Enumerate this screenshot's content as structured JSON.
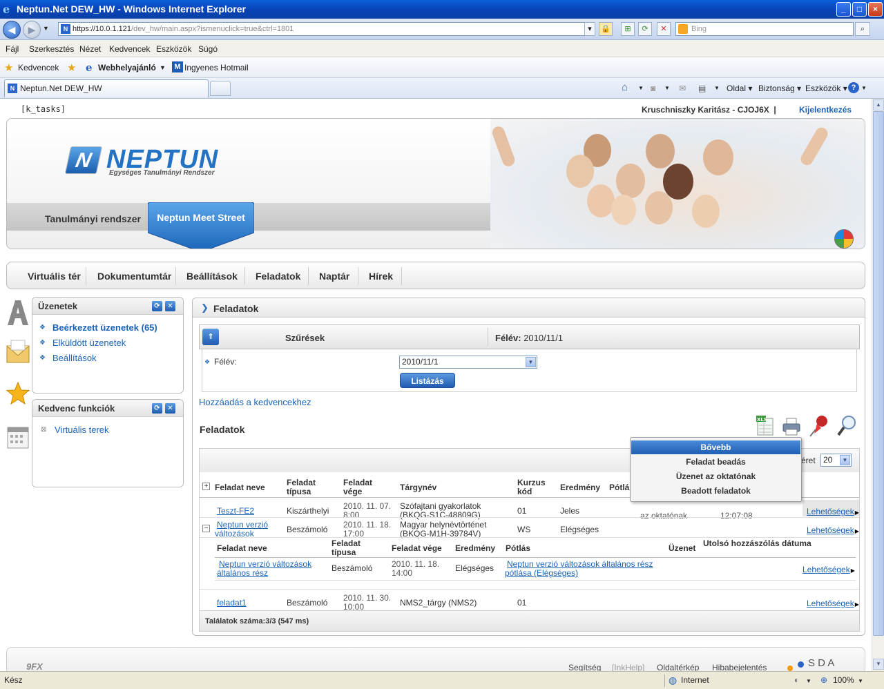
{
  "window": {
    "title": "Neptun.Net DEW_HW - Windows Internet Explorer",
    "url_main": "https://10.0.1.121",
    "url_rest": "/dev_hw/main.aspx?ismenuclick=true&ctrl=1801",
    "search_placeholder": "Bing"
  },
  "menubar": [
    "Fájl",
    "Szerkesztés",
    "Nézet",
    "Kedvencek",
    "Eszközök",
    "Súgó"
  ],
  "favbar": {
    "favorites": "Kedvencek",
    "suggested": "Webhelyajánló",
    "hotmail": "Ingyenes Hotmail"
  },
  "tab": {
    "label": "Neptun.Net DEW_HW"
  },
  "commandbar": {
    "page": "Oldal",
    "security": "Biztonság",
    "tools": "Eszközök"
  },
  "header": {
    "k_tasks": "[k_tasks]",
    "user": "Kruschniszky Karitász - CJOJ6X",
    "separator": "|",
    "logout": "Kijelentkezés",
    "logo_word": "NEPTUN",
    "logo_sub": "Egységes Tanulmányi Rendszer",
    "tab_system": "Tanulmányi rendszer",
    "tab_meet": "Neptun Meet Street"
  },
  "nav": [
    "Virtuális tér",
    "Dokumentumtár",
    "Beállítások",
    "Feladatok",
    "Naptár",
    "Hírek"
  ],
  "messages": {
    "title": "Üzenetek",
    "items": [
      "Beérkezett üzenetek (65)",
      "Elküldött üzenetek",
      "Beállítások"
    ]
  },
  "favorites_box": {
    "title": "Kedvenc funkciók",
    "items": [
      "Virtuális terek"
    ]
  },
  "main": {
    "title": "Feladatok",
    "filter_title": "Szűrések",
    "semester_label": "Félév:",
    "semester_value": "2010/11/1",
    "field_label": "Félév:",
    "select_value": "2010/11/1",
    "list_button": "Listázás",
    "add_fav": "Hozzáadás a kedvencekhez",
    "section_title": "Feladatok",
    "page_size_label": "éret",
    "page_size": "20",
    "columns": [
      "Feladat neve",
      "Feladat típusa",
      "Feladat vége",
      "Tárgynév",
      "Kurzus kód",
      "Eredmény",
      "Pótlás"
    ],
    "rows": [
      {
        "name": "Teszt-FE2",
        "type": "Kiszárthelyi",
        "end1": "2010. 11. 07.",
        "end2": "8:00",
        "subject1": "Szófajtani gyakorlatok",
        "subject2": "(BKQG-S1C-48809G)",
        "course": "01",
        "result": "Jeles",
        "msg": "az oktatónak",
        "last": "12:07:08",
        "options": "Lehetőségek"
      },
      {
        "name1": "Neptun verzió",
        "name2": "változások",
        "type": "Beszámoló",
        "end1": "2010. 11. 18.",
        "end2": "17:00",
        "subject1": "Magyar helynévtörténet",
        "subject2": "(BKQG-M1H-39784V)",
        "course": "WS",
        "result": "Elégséges",
        "options": "Lehetőségek"
      },
      {
        "name": "feladat1",
        "type": "Beszámoló",
        "end1": "2010. 11. 30.",
        "end2": "10:00",
        "subject": "NMS2_tárgy (NMS2)",
        "course": "01",
        "options": "Lehetőségek"
      }
    ],
    "subtable": {
      "columns": [
        "Feladat neve",
        "Feladat típusa",
        "Feladat vége",
        "Eredmény",
        "Pótlás",
        "Üzenet",
        "Utolsó hozzászólás dátuma"
      ],
      "row": {
        "name1": "Neptun verzió változások",
        "name2": "általános rész",
        "type": "Beszámoló",
        "end1": "2010. 11. 18.",
        "end2": "14:00",
        "result": "Elégséges",
        "makeup1": "Neptun verzió változások általános rész",
        "makeup2": "pótlása (Elégséges)",
        "options": "Lehetőségek"
      }
    },
    "results_count": "Találatok száma:3/3 (547 ms)"
  },
  "popup": [
    "Bővebb",
    "Feladat beadás",
    "Üzenet az oktatónak",
    "Beadott feladatok"
  ],
  "footer": {
    "brand": "9FX",
    "links": [
      "Segítség",
      "[InkHelp]",
      "Oldaltérkép",
      "Hibabejelentés"
    ],
    "sda": "S D A"
  },
  "statusbar": {
    "left": "Kész",
    "zone": "Internet",
    "zoom": "100%"
  }
}
